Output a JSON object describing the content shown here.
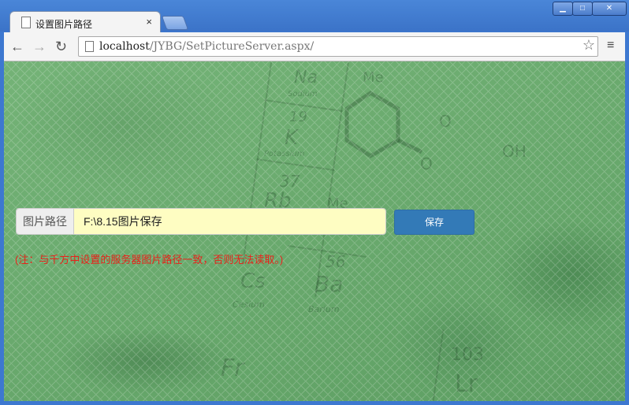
{
  "browser": {
    "tab_title": "设置图片路径",
    "tab_close": "×",
    "url_host": "localhost",
    "url_path": "/JYBG/SetPictureServer.aspx/",
    "window_controls": {
      "minimize": "▁",
      "maximize": "□",
      "close": "✕"
    },
    "icons": {
      "back": "back-arrow-icon",
      "forward": "forward-arrow-icon",
      "reload": "reload-icon",
      "star": "bookmark-star-icon",
      "menu": "menu-icon"
    }
  },
  "background_text": {
    "na": "Na",
    "na_name": "Sodium",
    "k_num": "19",
    "k": "K",
    "k_name": "Potassium",
    "rb_num": "37",
    "rb": "Rb",
    "cs": "Cs",
    "cs_name": "Cesium",
    "ba_num": "56",
    "ba": "Ba",
    "ba_name": "Barium",
    "fr": "Fr",
    "lr_num": "103",
    "lr": "Lr",
    "me1": "Me",
    "me2": "Me",
    "oh": "OH",
    "o1": "O",
    "o2": "O"
  },
  "form": {
    "label": "图片路径",
    "value": "F:\\8.15图片保存",
    "save_label": "保存",
    "note": "(注：与千方中设置的服务器图片路径一致，否则无法读取。)"
  },
  "colors": {
    "accent": "#337ab7",
    "note": "#e8221a",
    "input_bg": "#fefdc2",
    "page_bg": "#6fae72"
  }
}
